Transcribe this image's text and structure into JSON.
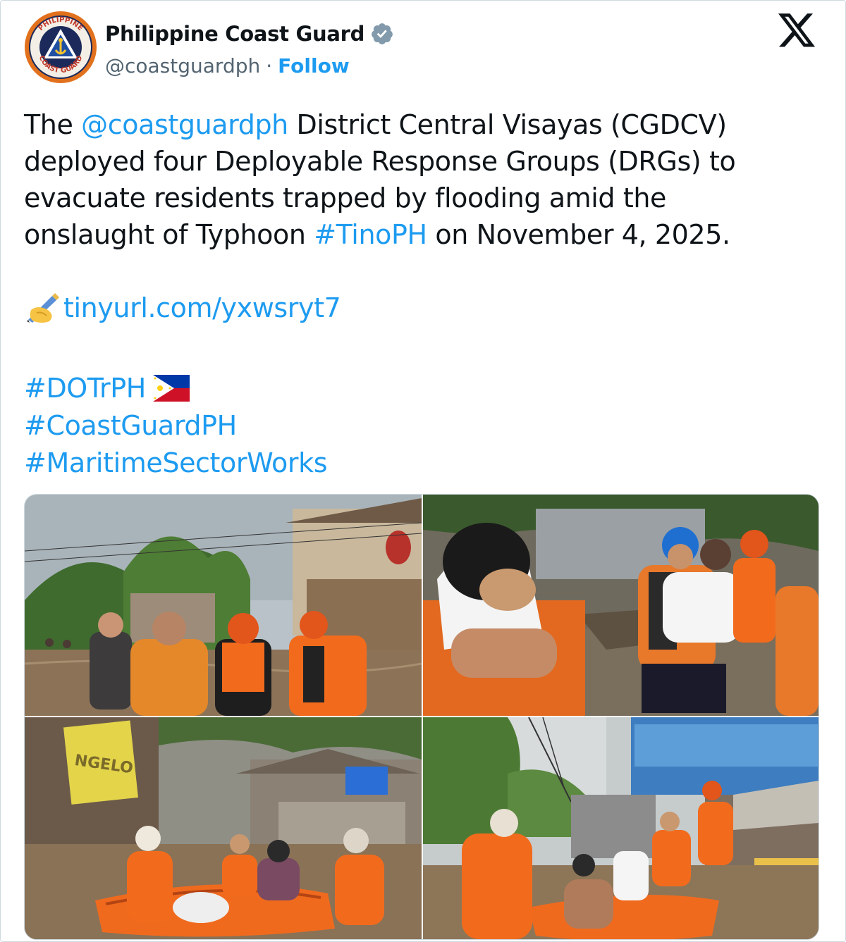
{
  "account": {
    "display_name": "Philippine Coast Guard",
    "handle": "@coastguardph",
    "separator": "·",
    "follow_label": "Follow",
    "avatar_icon": "philippine-coast-guard-seal",
    "avatar_text_top": "PHILIPPINE",
    "avatar_text_bottom": "COAST GUARD",
    "verified_icon": "verified-badge-icon"
  },
  "platform_logo": "x-logo-icon",
  "tweet": {
    "line1_a": "The ",
    "line1_mention": "@coastguardph",
    "line1_b": " District Central Visayas (CGDCV)",
    "line2": "deployed four Deployable Response Groups (DRGs) to",
    "line3": "evacuate residents trapped by flooding amid the",
    "line4_a": "onslaught of Typhoon ",
    "line4_hashtag": "#TinoPH",
    "line4_b": " on November 4, 2025.",
    "link_emoji": "writing-hand-emoji",
    "link_text": "tinyurl.com/yxwsryt7",
    "hashtags": [
      "#DOTrPH",
      "#CoastGuardPH",
      "#MaritimeSectorWorks"
    ],
    "flag_emoji": "philippines-flag-emoji"
  },
  "media": {
    "photos": [
      "flooded-street-coast-guard-rescuers-with-residents",
      "rescuer-carrying-child-through-debris",
      "rescue-boat-with-residents-in-flooded-alley",
      "residents-boarding-orange-rescue-boat"
    ],
    "sign_text": "NGELO"
  },
  "colors": {
    "link": "#1d9bf0",
    "text": "#0f1419",
    "muted": "#536471",
    "border": "#cfd9de"
  }
}
